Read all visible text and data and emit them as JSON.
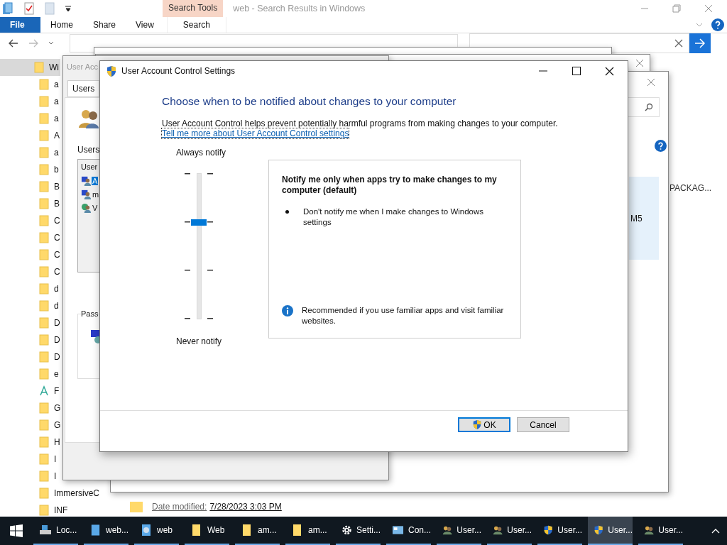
{
  "explorer": {
    "title": "web - Search Results in Windows",
    "context_tab": "Search Tools",
    "ribbon_tabs": [
      {
        "label": "File",
        "kind": "file"
      },
      {
        "label": "Home",
        "kind": "plain"
      },
      {
        "label": "Share",
        "kind": "plain"
      },
      {
        "label": "View",
        "kind": "plain"
      },
      {
        "label": "Search",
        "kind": "contextual"
      }
    ],
    "nav_tree": [
      {
        "label": "Wi",
        "kind": "folder",
        "selected": true,
        "children": [
          {
            "label": "a",
            "kind": "folder",
            "selected": false
          },
          {
            "label": "a",
            "kind": "folder",
            "selected": false
          },
          {
            "label": "a",
            "kind": "folder",
            "selected": false
          },
          {
            "label": "A",
            "kind": "folder",
            "selected": false
          },
          {
            "label": "a",
            "kind": "folder",
            "selected": false
          },
          {
            "label": "b",
            "kind": "folder",
            "selected": false
          },
          {
            "label": "B",
            "kind": "folder",
            "selected": false
          },
          {
            "label": "B",
            "kind": "folder",
            "selected": false
          },
          {
            "label": "C",
            "kind": "folder",
            "selected": false
          },
          {
            "label": "C",
            "kind": "folder",
            "selected": false
          },
          {
            "label": "C",
            "kind": "folder",
            "selected": false
          },
          {
            "label": "C",
            "kind": "folder",
            "selected": false
          },
          {
            "label": "d",
            "kind": "folder",
            "selected": false
          },
          {
            "label": "d",
            "kind": "folder",
            "selected": false
          },
          {
            "label": "D",
            "kind": "folder",
            "selected": false
          },
          {
            "label": "D",
            "kind": "folder",
            "selected": false
          },
          {
            "label": "D",
            "kind": "folder",
            "selected": false
          },
          {
            "label": "e",
            "kind": "folder",
            "selected": false
          },
          {
            "label": "F",
            "kind": "font",
            "selected": false
          },
          {
            "label": "G",
            "kind": "folder",
            "selected": false
          },
          {
            "label": "G",
            "kind": "folder",
            "selected": false
          },
          {
            "label": "H",
            "kind": "folder",
            "selected": false
          },
          {
            "label": "I",
            "kind": "folder",
            "selected": false
          },
          {
            "label": "I",
            "kind": "folder",
            "selected": false
          },
          {
            "label": "ImmersiveC",
            "kind": "folder",
            "selected": false
          },
          {
            "label": "INF",
            "kind": "folder",
            "selected": false
          }
        ]
      }
    ],
    "result_name": "PACKAG...",
    "date_label": "Date modified:",
    "date": "7/28/2023 3:03 PM"
  },
  "accounts_window": {
    "title": "User Acc",
    "tab": "Users",
    "users_label": "Users",
    "list_header": "User",
    "users": [
      {
        "label": "A",
        "kind": "admin",
        "selected": true
      },
      {
        "label": "m",
        "kind": "admin",
        "selected": false
      },
      {
        "label": "V",
        "kind": "guest",
        "selected": false
      }
    ],
    "password_group": "Pass"
  },
  "back_window": {
    "item_text": "M5"
  },
  "uac_dialog": {
    "title": "User Account Control Settings",
    "heading": "Choose when to be notified about changes to your computer",
    "intro": "User Account Control helps prevent potentially harmful programs from making changes to your computer.",
    "link": "Tell me more about User Account Control settings",
    "slider": {
      "top_label": "Always notify",
      "bottom_label": "Never notify",
      "level": 0.667
    },
    "panel": {
      "title": "Notify me only when apps try to make changes to my computer (default)",
      "bullets": [
        "Don't notify me when I make changes to Windows settings"
      ],
      "note": "Recommended if you use familiar apps and visit familiar websites."
    },
    "buttons": [
      {
        "label": "OK",
        "kind": "admin",
        "default": true
      },
      {
        "label": "Cancel",
        "kind": "plain",
        "default": false
      }
    ]
  },
  "taskbar": [
    {
      "label": "Loc...",
      "kind": "drive",
      "selected": false
    },
    {
      "label": "web...",
      "kind": "cube",
      "selected": false
    },
    {
      "label": "web",
      "kind": "search",
      "selected": false
    },
    {
      "label": "Web",
      "kind": "folder",
      "selected": false
    },
    {
      "label": "am...",
      "kind": "folder",
      "selected": false
    },
    {
      "label": "am...",
      "kind": "folder",
      "selected": false
    },
    {
      "label": "Setti...",
      "kind": "gear",
      "selected": false
    },
    {
      "label": "Con...",
      "kind": "panel",
      "selected": false
    },
    {
      "label": "User...",
      "kind": "users",
      "selected": false
    },
    {
      "label": "User...",
      "kind": "users",
      "selected": false
    },
    {
      "label": "User...",
      "kind": "shield",
      "selected": false
    },
    {
      "label": "User...",
      "kind": "shield",
      "selected": true
    },
    {
      "label": "User...",
      "kind": "users",
      "selected": false
    }
  ]
}
